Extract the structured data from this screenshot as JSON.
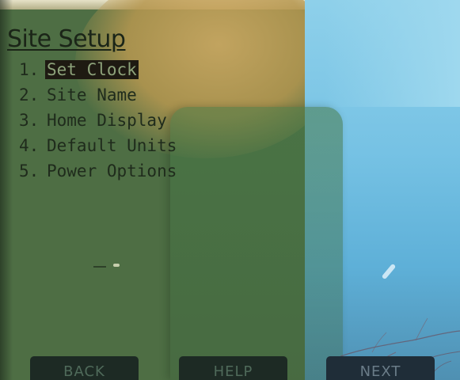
{
  "screen": {
    "title": "Site Setup",
    "menu": [
      {
        "number": "1.",
        "label": "Set Clock",
        "selected": true
      },
      {
        "number": "2.",
        "label": "Site Name",
        "selected": false
      },
      {
        "number": "3.",
        "label": "Home Display",
        "selected": false
      },
      {
        "number": "4.",
        "label": "Default Units",
        "selected": false
      },
      {
        "number": "5.",
        "label": "Power Options",
        "selected": false
      }
    ],
    "softkeys": {
      "back": "BACK",
      "help": "HELP",
      "next": "NEXT"
    }
  },
  "colors": {
    "lcd_green": "#4e6e44",
    "lcd_text": "#1f2b1c",
    "selection_bg": "#1e1a12",
    "sky_blue": "#76c2e4",
    "softkey_bg": "#1d2a24"
  }
}
